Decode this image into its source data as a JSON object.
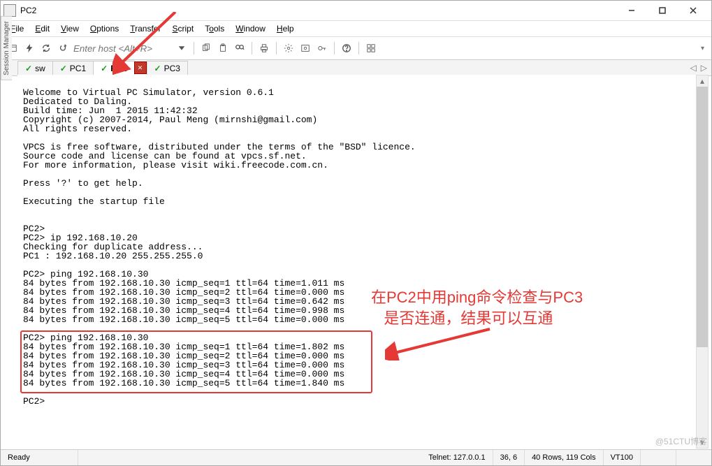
{
  "window": {
    "title": "PC2"
  },
  "menu": {
    "items": [
      "File",
      "Edit",
      "View",
      "Options",
      "Transfer",
      "Script",
      "Tools",
      "Window",
      "Help"
    ],
    "hotkeys": [
      "F",
      "E",
      "V",
      "O",
      "T",
      "S",
      "T",
      "W",
      "H"
    ]
  },
  "toolbar": {
    "host_placeholder": "Enter host <Alt+R>",
    "icons": [
      "session-settings-icon",
      "lightning-icon",
      "refresh-icon",
      "reconnect-icon",
      "host-input",
      "history-dropdown-icon",
      "sep",
      "copy-icon",
      "paste-icon",
      "find-icon",
      "sep",
      "print-icon",
      "sep",
      "settings-icon",
      "session-options-icon",
      "key-icon",
      "sep",
      "help-icon",
      "sep",
      "tile-icon"
    ]
  },
  "side_tab": "Session Manager",
  "tabs": [
    {
      "name": "sw",
      "active": false
    },
    {
      "name": "PC1",
      "active": false
    },
    {
      "name": "PC2",
      "active": true
    },
    {
      "name": "PC3",
      "active": false
    }
  ],
  "map_button": "✕",
  "terminal_lines": [
    "",
    "Welcome to Virtual PC Simulator, version 0.6.1",
    "Dedicated to Daling.",
    "Build time: Jun  1 2015 11:42:32",
    "Copyright (c) 2007-2014, Paul Meng (mirnshi@gmail.com)",
    "All rights reserved.",
    "",
    "VPCS is free software, distributed under the terms of the \"BSD\" licence.",
    "Source code and license can be found at vpcs.sf.net.",
    "For more information, please visit wiki.freecode.com.cn.",
    "",
    "Press '?' to get help.",
    "",
    "Executing the startup file",
    "",
    "",
    "PC2>",
    "PC2> ip 192.168.10.20",
    "Checking for duplicate address...",
    "PC1 : 192.168.10.20 255.255.255.0",
    "",
    "PC2> ping 192.168.10.30",
    "84 bytes from 192.168.10.30 icmp_seq=1 ttl=64 time=1.011 ms",
    "84 bytes from 192.168.10.30 icmp_seq=2 ttl=64 time=0.000 ms",
    "84 bytes from 192.168.10.30 icmp_seq=3 ttl=64 time=0.642 ms",
    "84 bytes from 192.168.10.30 icmp_seq=4 ttl=64 time=0.998 ms",
    "84 bytes from 192.168.10.30 icmp_seq=5 ttl=64 time=0.000 ms",
    "",
    "PC2> ping 192.168.10.30",
    "84 bytes from 192.168.10.30 icmp_seq=1 ttl=64 time=1.802 ms",
    "84 bytes from 192.168.10.30 icmp_seq=2 ttl=64 time=0.000 ms",
    "84 bytes from 192.168.10.30 icmp_seq=3 ttl=64 time=0.000 ms",
    "84 bytes from 192.168.10.30 icmp_seq=4 ttl=64 time=0.000 ms",
    "84 bytes from 192.168.10.30 icmp_seq=5 ttl=64 time=1.840 ms",
    "",
    "PC2>"
  ],
  "annotation": {
    "line1": "在PC2中用ping命令检查与PC3",
    "line2": "是否连通，结果可以互通"
  },
  "status": {
    "ready": "Ready",
    "conn": "Telnet: 127.0.0.1",
    "pos": "36,  6",
    "size": "40 Rows, 119 Cols",
    "emul": "VT100"
  },
  "watermark": "@51CTU博客"
}
